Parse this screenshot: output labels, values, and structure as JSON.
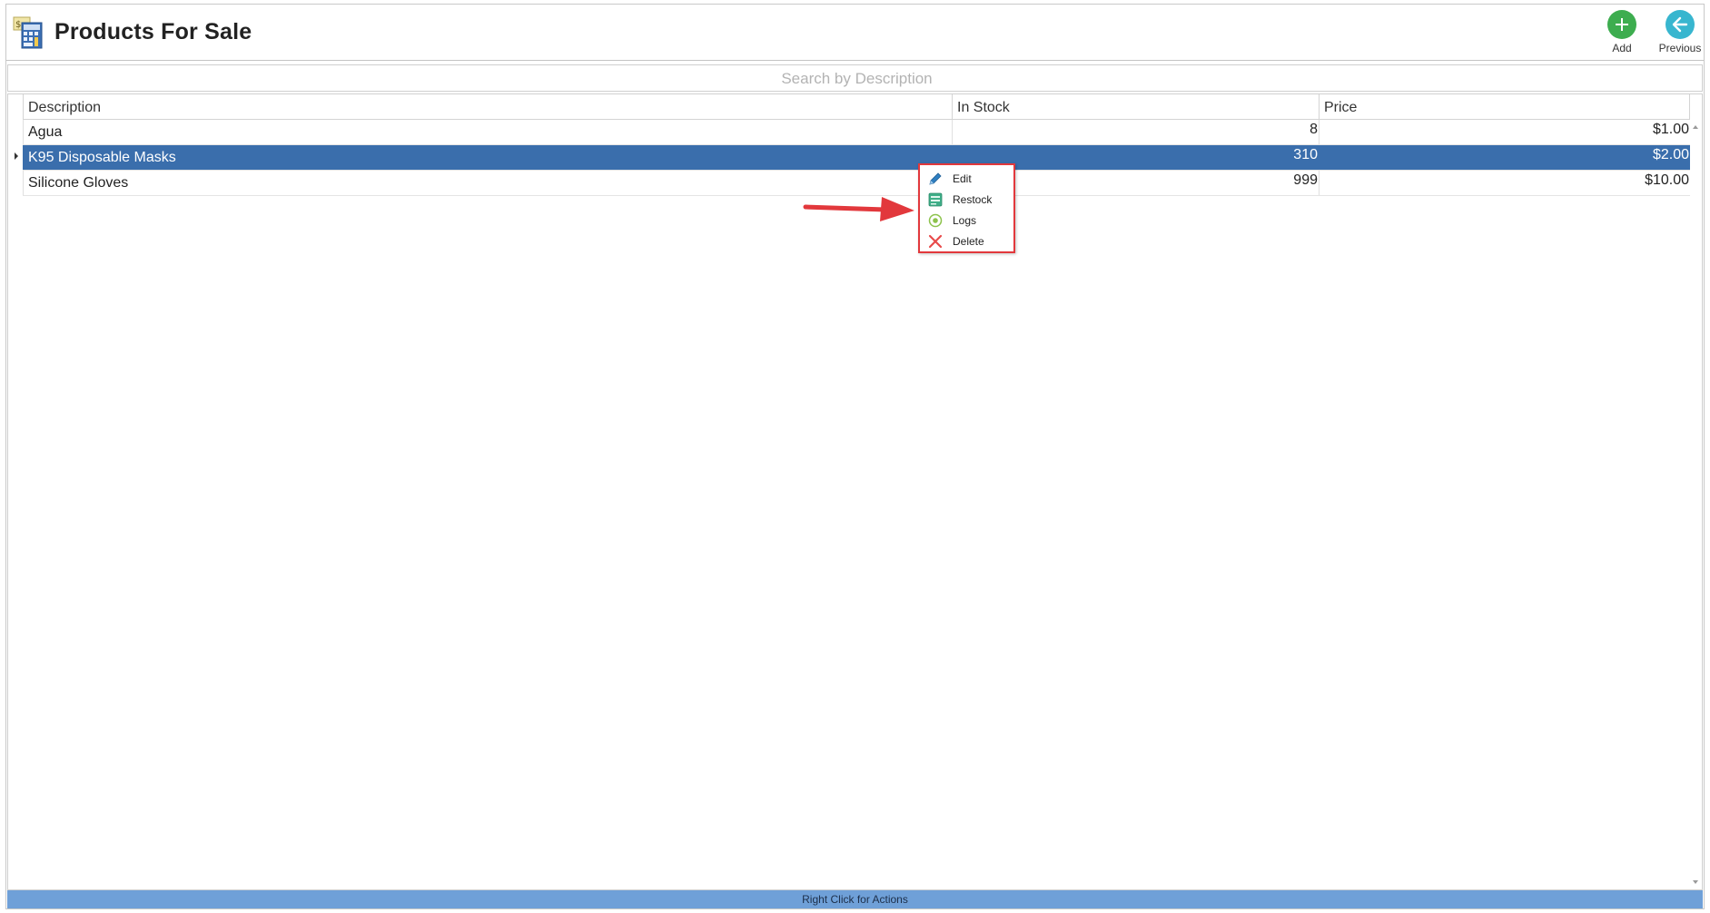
{
  "header": {
    "title": "Products For Sale",
    "add_label": "Add",
    "previous_label": "Previous"
  },
  "search": {
    "placeholder": "Search by Description",
    "value": ""
  },
  "table": {
    "columns": [
      "Description",
      "In Stock",
      "Price"
    ],
    "rows": [
      {
        "description": "Agua",
        "in_stock": "8",
        "price": "$1.00"
      },
      {
        "description": "K95 Disposable Masks",
        "in_stock": "310",
        "price": "$2.00"
      },
      {
        "description": "Silicone Gloves",
        "in_stock": "999",
        "price": "$10.00"
      }
    ],
    "selected_row": "K95 Disposable Masks"
  },
  "context_menu": {
    "items": [
      {
        "label": "Edit",
        "icon": "pencil-icon"
      },
      {
        "label": "Restock",
        "icon": "restock-icon"
      },
      {
        "label": "Logs",
        "icon": "logs-icon"
      },
      {
        "label": "Delete",
        "icon": "delete-x-icon"
      }
    ]
  },
  "status_bar": {
    "text": "Right Click for Actions"
  },
  "colors": {
    "selection": "#3a6eac",
    "status_bar": "#6fa0d8",
    "add_button": "#3dad4f",
    "previous_button": "#38b6cf",
    "highlight_border": "#e2383c",
    "annotation_arrow": "#e2383c"
  }
}
